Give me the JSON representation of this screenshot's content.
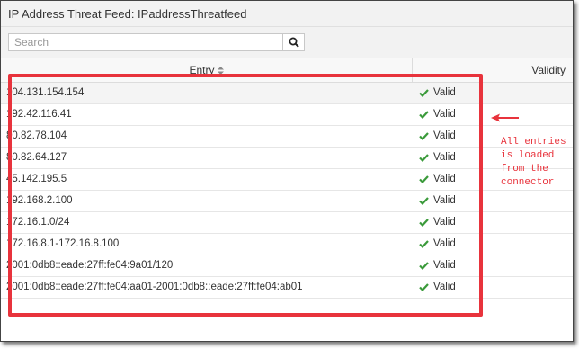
{
  "window": {
    "title": "IP Address Threat Feed: IPaddressThreatfeed"
  },
  "search": {
    "placeholder": "Search",
    "value": ""
  },
  "table": {
    "columns": {
      "entry": "Entry",
      "validity": "Validity"
    },
    "rows": [
      {
        "entry": "104.131.154.154",
        "validity": "Valid"
      },
      {
        "entry": "192.42.116.41",
        "validity": "Valid"
      },
      {
        "entry": "80.82.78.104",
        "validity": "Valid"
      },
      {
        "entry": "80.82.64.127",
        "validity": "Valid"
      },
      {
        "entry": "45.142.195.5",
        "validity": "Valid"
      },
      {
        "entry": "192.168.2.100",
        "validity": "Valid"
      },
      {
        "entry": "172.16.1.0/24",
        "validity": "Valid"
      },
      {
        "entry": "172.16.8.1-172.16.8.100",
        "validity": "Valid"
      },
      {
        "entry": "2001:0db8::eade:27ff:fe04:9a01/120",
        "validity": "Valid"
      },
      {
        "entry": "2001:0db8::eade:27ff:fe04:aa01-2001:0db8::eade:27ff:fe04:ab01",
        "validity": "Valid"
      }
    ]
  },
  "annotation": {
    "text": "All entries\nis loaded\nfrom the\nconnector"
  },
  "colors": {
    "highlight": "#e8333c",
    "check": "#3a9a3a"
  },
  "icons": {
    "search": "search-icon",
    "sort": "sort-icon",
    "check": "check-icon",
    "arrow": "arrow-left-icon"
  }
}
